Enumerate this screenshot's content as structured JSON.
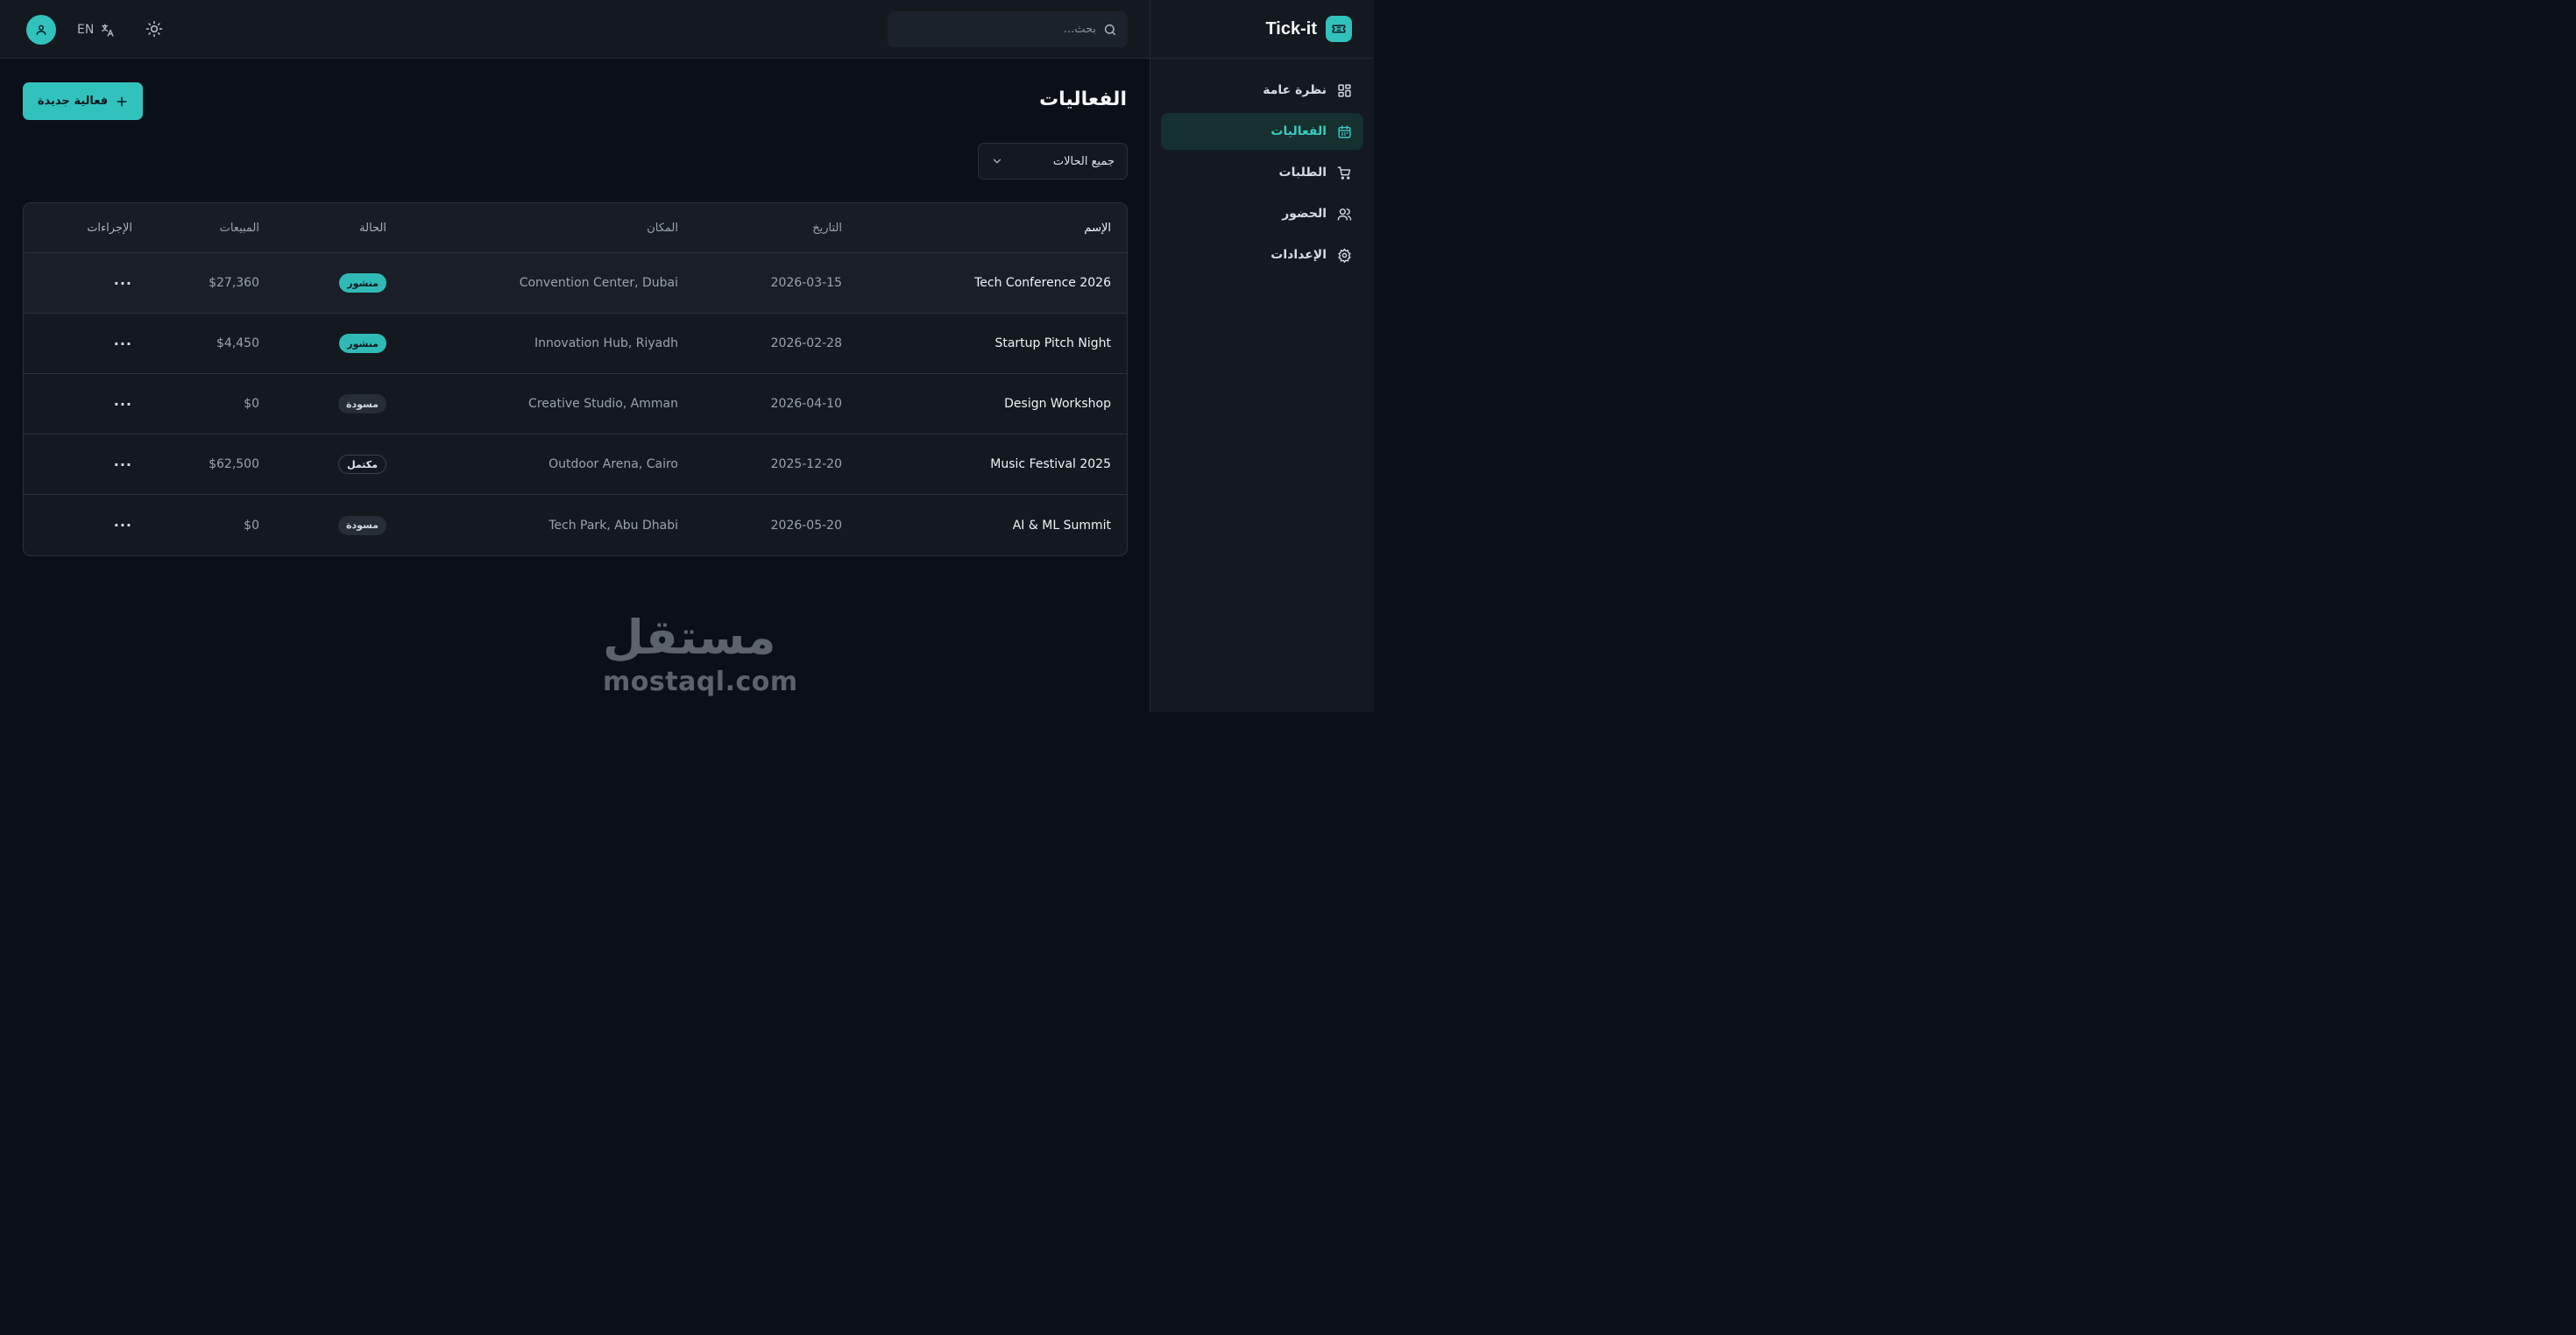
{
  "app": {
    "name": "Tick-it",
    "accent": "#32c2bd"
  },
  "sidebar": {
    "items": [
      {
        "label": "نظرة عامة",
        "icon": "dashboard-grid-icon",
        "active": false
      },
      {
        "label": "الفعاليات",
        "icon": "calendar-icon",
        "active": true
      },
      {
        "label": "الطلبات",
        "icon": "cart-icon",
        "active": false
      },
      {
        "label": "الحضور",
        "icon": "users-icon",
        "active": false
      },
      {
        "label": "الإعدادات",
        "icon": "gear-icon",
        "active": false
      }
    ]
  },
  "topbar": {
    "search_placeholder": "بحث...",
    "lang_label": "EN",
    "lang_icon": "translate-icon",
    "theme_icon": "sun-icon",
    "avatar_icon": "user-icon"
  },
  "main": {
    "title": "الفعاليات",
    "new_button_label": "فعالية جديدة",
    "filter_value": "جميع الحالات"
  },
  "table": {
    "headers": {
      "name": "الإسم",
      "date": "التاريخ",
      "venue": "المكان",
      "status": "الحالة",
      "sales": "المبيعات",
      "actions": "الإجراءات"
    },
    "rows": [
      {
        "name": "Tech Conference 2026",
        "date": "2026-03-15",
        "venue": "Convention Center, Dubai",
        "status": "منشور",
        "status_type": "published",
        "sales": "$27,360",
        "actions": "···"
      },
      {
        "name": "Startup Pitch Night",
        "date": "2026-02-28",
        "venue": "Innovation Hub, Riyadh",
        "status": "منشور",
        "status_type": "published",
        "sales": "$4,450",
        "actions": "···"
      },
      {
        "name": "Design Workshop",
        "date": "2026-04-10",
        "venue": "Creative Studio, Amman",
        "status": "مسودة",
        "status_type": "draft",
        "sales": "$0",
        "actions": "···"
      },
      {
        "name": "Music Festival 2025",
        "date": "2025-12-20",
        "venue": "Outdoor Arena, Cairo",
        "status": "مكتمل",
        "status_type": "done",
        "sales": "$62,500",
        "actions": "···"
      },
      {
        "name": "AI & ML Summit",
        "date": "2026-05-20",
        "venue": "Tech Park, Abu Dhabi",
        "status": "مسودة",
        "status_type": "draft",
        "sales": "$0",
        "actions": "···"
      }
    ]
  },
  "watermark": {
    "arabic": "مستقل",
    "latin": "mostaql.com"
  }
}
